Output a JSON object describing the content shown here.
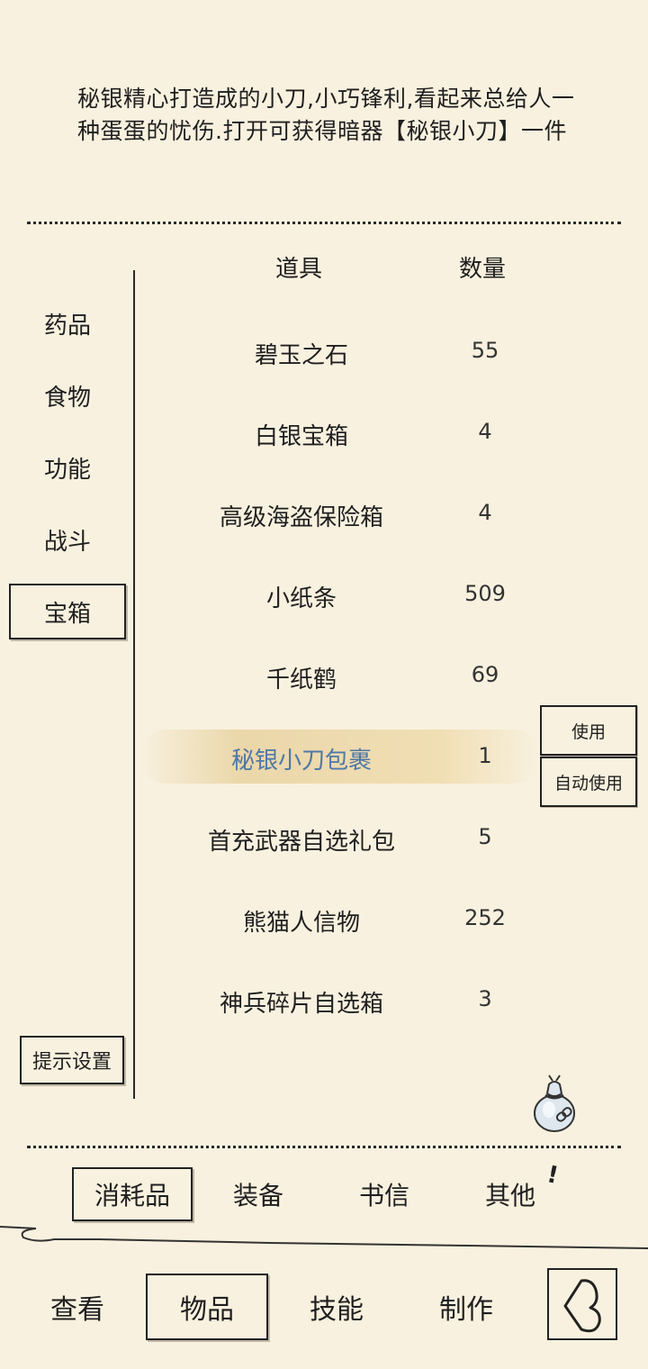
{
  "description": "秘银精心打造成的小刀,小巧锋利,看起来总给人一种蛋蛋的忧伤.打开可获得暗器【秘银小刀】一件",
  "categories": [
    {
      "label": "药品"
    },
    {
      "label": "食物"
    },
    {
      "label": "功能"
    },
    {
      "label": "战斗"
    },
    {
      "label": "宝箱",
      "selected": true
    }
  ],
  "columns": {
    "item": "道具",
    "qty": "数量"
  },
  "items": [
    {
      "name": "碧玉之石",
      "qty": "55"
    },
    {
      "name": "白银宝箱",
      "qty": "4"
    },
    {
      "name": "高级海盗保险箱",
      "qty": "4"
    },
    {
      "name": "小纸条",
      "qty": "509"
    },
    {
      "name": "千纸鹤",
      "qty": "69"
    },
    {
      "name": "秘银小刀包裹",
      "qty": "1",
      "selected": true
    },
    {
      "name": "首充武器自选礼包",
      "qty": "5"
    },
    {
      "name": "熊猫人信物",
      "qty": "252"
    },
    {
      "name": "神兵碎片自选箱",
      "qty": "3"
    }
  ],
  "actions": {
    "use": "使用",
    "auto_use": "自动使用"
  },
  "hint_settings": "提示设置",
  "bag_tabs": [
    {
      "label": "消耗品",
      "selected": true
    },
    {
      "label": "装备"
    },
    {
      "label": "书信"
    },
    {
      "label": "其他"
    }
  ],
  "notice": "!",
  "nav_tabs": [
    {
      "label": "查看"
    },
    {
      "label": "物品",
      "selected": true
    },
    {
      "label": "技能"
    },
    {
      "label": "制作"
    }
  ],
  "icons": {
    "bag": "bag-icon",
    "back": "back-arrow-icon"
  }
}
